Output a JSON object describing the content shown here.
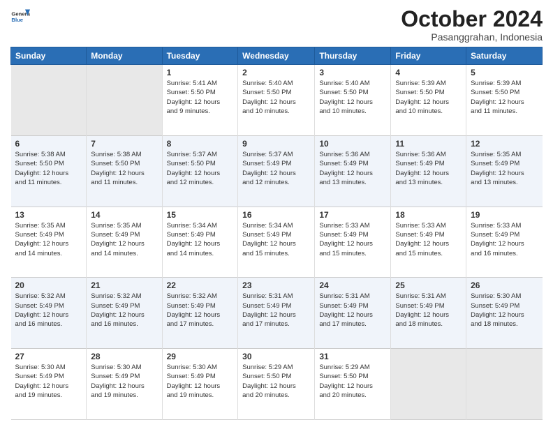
{
  "logo": {
    "general": "General",
    "blue": "Blue"
  },
  "title": "October 2024",
  "subtitle": "Pasanggrahan, Indonesia",
  "days_header": [
    "Sunday",
    "Monday",
    "Tuesday",
    "Wednesday",
    "Thursday",
    "Friday",
    "Saturday"
  ],
  "weeks": [
    [
      {
        "day": "",
        "empty": true
      },
      {
        "day": "",
        "empty": true
      },
      {
        "day": "1",
        "sunrise": "5:41 AM",
        "sunset": "5:50 PM",
        "daylight": "12 hours and 9 minutes."
      },
      {
        "day": "2",
        "sunrise": "5:40 AM",
        "sunset": "5:50 PM",
        "daylight": "12 hours and 10 minutes."
      },
      {
        "day": "3",
        "sunrise": "5:40 AM",
        "sunset": "5:50 PM",
        "daylight": "12 hours and 10 minutes."
      },
      {
        "day": "4",
        "sunrise": "5:39 AM",
        "sunset": "5:50 PM",
        "daylight": "12 hours and 10 minutes."
      },
      {
        "day": "5",
        "sunrise": "5:39 AM",
        "sunset": "5:50 PM",
        "daylight": "12 hours and 11 minutes."
      }
    ],
    [
      {
        "day": "6",
        "sunrise": "5:38 AM",
        "sunset": "5:50 PM",
        "daylight": "12 hours and 11 minutes."
      },
      {
        "day": "7",
        "sunrise": "5:38 AM",
        "sunset": "5:50 PM",
        "daylight": "12 hours and 11 minutes."
      },
      {
        "day": "8",
        "sunrise": "5:37 AM",
        "sunset": "5:50 PM",
        "daylight": "12 hours and 12 minutes."
      },
      {
        "day": "9",
        "sunrise": "5:37 AM",
        "sunset": "5:49 PM",
        "daylight": "12 hours and 12 minutes."
      },
      {
        "day": "10",
        "sunrise": "5:36 AM",
        "sunset": "5:49 PM",
        "daylight": "12 hours and 13 minutes."
      },
      {
        "day": "11",
        "sunrise": "5:36 AM",
        "sunset": "5:49 PM",
        "daylight": "12 hours and 13 minutes."
      },
      {
        "day": "12",
        "sunrise": "5:35 AM",
        "sunset": "5:49 PM",
        "daylight": "12 hours and 13 minutes."
      }
    ],
    [
      {
        "day": "13",
        "sunrise": "5:35 AM",
        "sunset": "5:49 PM",
        "daylight": "12 hours and 14 minutes."
      },
      {
        "day": "14",
        "sunrise": "5:35 AM",
        "sunset": "5:49 PM",
        "daylight": "12 hours and 14 minutes."
      },
      {
        "day": "15",
        "sunrise": "5:34 AM",
        "sunset": "5:49 PM",
        "daylight": "12 hours and 14 minutes."
      },
      {
        "day": "16",
        "sunrise": "5:34 AM",
        "sunset": "5:49 PM",
        "daylight": "12 hours and 15 minutes."
      },
      {
        "day": "17",
        "sunrise": "5:33 AM",
        "sunset": "5:49 PM",
        "daylight": "12 hours and 15 minutes."
      },
      {
        "day": "18",
        "sunrise": "5:33 AM",
        "sunset": "5:49 PM",
        "daylight": "12 hours and 15 minutes."
      },
      {
        "day": "19",
        "sunrise": "5:33 AM",
        "sunset": "5:49 PM",
        "daylight": "12 hours and 16 minutes."
      }
    ],
    [
      {
        "day": "20",
        "sunrise": "5:32 AM",
        "sunset": "5:49 PM",
        "daylight": "12 hours and 16 minutes."
      },
      {
        "day": "21",
        "sunrise": "5:32 AM",
        "sunset": "5:49 PM",
        "daylight": "12 hours and 16 minutes."
      },
      {
        "day": "22",
        "sunrise": "5:32 AM",
        "sunset": "5:49 PM",
        "daylight": "12 hours and 17 minutes."
      },
      {
        "day": "23",
        "sunrise": "5:31 AM",
        "sunset": "5:49 PM",
        "daylight": "12 hours and 17 minutes."
      },
      {
        "day": "24",
        "sunrise": "5:31 AM",
        "sunset": "5:49 PM",
        "daylight": "12 hours and 17 minutes."
      },
      {
        "day": "25",
        "sunrise": "5:31 AM",
        "sunset": "5:49 PM",
        "daylight": "12 hours and 18 minutes."
      },
      {
        "day": "26",
        "sunrise": "5:30 AM",
        "sunset": "5:49 PM",
        "daylight": "12 hours and 18 minutes."
      }
    ],
    [
      {
        "day": "27",
        "sunrise": "5:30 AM",
        "sunset": "5:49 PM",
        "daylight": "12 hours and 19 minutes."
      },
      {
        "day": "28",
        "sunrise": "5:30 AM",
        "sunset": "5:49 PM",
        "daylight": "12 hours and 19 minutes."
      },
      {
        "day": "29",
        "sunrise": "5:30 AM",
        "sunset": "5:49 PM",
        "daylight": "12 hours and 19 minutes."
      },
      {
        "day": "30",
        "sunrise": "5:29 AM",
        "sunset": "5:50 PM",
        "daylight": "12 hours and 20 minutes."
      },
      {
        "day": "31",
        "sunrise": "5:29 AM",
        "sunset": "5:50 PM",
        "daylight": "12 hours and 20 minutes."
      },
      {
        "day": "",
        "empty": true
      },
      {
        "day": "",
        "empty": true
      }
    ]
  ],
  "labels": {
    "sunrise": "Sunrise:",
    "sunset": "Sunset:",
    "daylight": "Daylight:"
  }
}
